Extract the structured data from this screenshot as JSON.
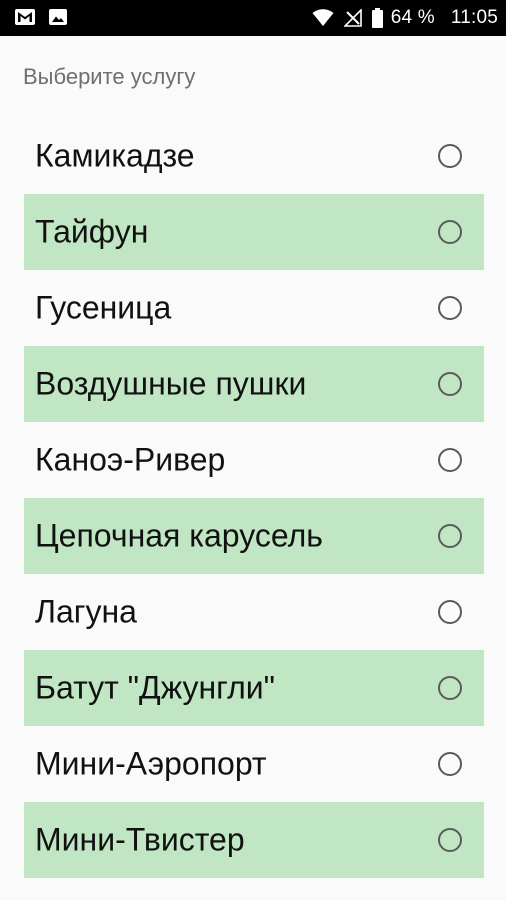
{
  "status_bar": {
    "left_icons": [
      "gmail-icon",
      "image-icon"
    ],
    "right_icons": [
      "wifi-icon",
      "no-signal-icon",
      "battery-icon"
    ],
    "battery": "64 %",
    "time": "11:05"
  },
  "page": {
    "title": "Выберите услугу"
  },
  "services": [
    {
      "label": "Камикадзе",
      "selected": false
    },
    {
      "label": "Тайфун",
      "selected": false
    },
    {
      "label": "Гусеница",
      "selected": false
    },
    {
      "label": "Воздушные пушки",
      "selected": false
    },
    {
      "label": "Каноэ-Ривер",
      "selected": false
    },
    {
      "label": "Цепочная карусель",
      "selected": false
    },
    {
      "label": "Лагуна",
      "selected": false
    },
    {
      "label": "Батут \"Джунгли\"",
      "selected": false
    },
    {
      "label": "Мини-Аэропорт",
      "selected": false
    },
    {
      "label": "Мини-Твистер",
      "selected": false
    }
  ],
  "colors": {
    "status_bar": "#000000",
    "background": "#fafafa",
    "alt_row": "#c1e6c3",
    "title_text": "#6f6f6f",
    "item_text": "#111111"
  }
}
